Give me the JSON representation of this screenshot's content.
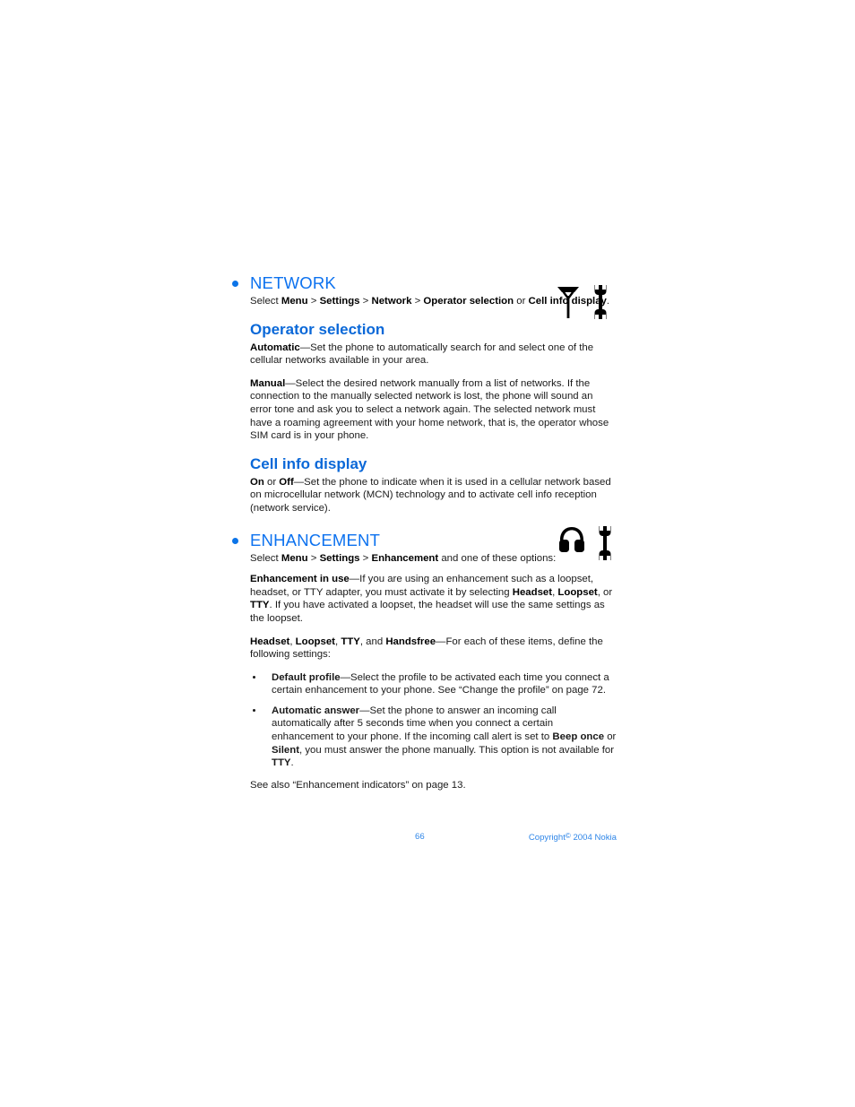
{
  "document": {
    "page_number": "66",
    "copyright_prefix": "Copyright",
    "copyright_symbol": "©",
    "copyright_suffix": "2004 Nokia",
    "accent_color": "#0d72ef",
    "subheading_color": "#0a68d8",
    "footer_color": "#2f86e8",
    "body_color": "#1a1a1a"
  },
  "sections": [
    {
      "id": "network",
      "title": "NETWORK",
      "icons": [
        "antenna-icon",
        "wrench-icon"
      ],
      "intro": {
        "segments": [
          {
            "text": "Select ",
            "bold": false
          },
          {
            "text": "Menu",
            "bold": true
          },
          {
            "text": " > ",
            "bold": false
          },
          {
            "text": "Settings",
            "bold": true
          },
          {
            "text": " > ",
            "bold": false
          },
          {
            "text": "Network",
            "bold": true
          },
          {
            "text": " > ",
            "bold": false
          },
          {
            "text": "Operator selection",
            "bold": true
          },
          {
            "text": " or ",
            "bold": false
          },
          {
            "text": "Cell info display",
            "bold": true
          },
          {
            "text": ".",
            "bold": false
          }
        ]
      },
      "subsections": [
        {
          "id": "operator-selection",
          "heading": "Operator selection",
          "paragraphs": [
            {
              "id": "automatic",
              "segments": [
                {
                  "text": "Automatic",
                  "bold": true
                },
                {
                  "text": "—Set the phone to automatically search for and select one of the cellular networks available in your area.",
                  "bold": false
                }
              ]
            },
            {
              "id": "manual",
              "segments": [
                {
                  "text": "Manual",
                  "bold": true
                },
                {
                  "text": "—Select the desired network manually from a list of networks. If the connection to the manually selected network is lost, the phone will sound an error tone and ask you to select a network again. The selected network must have a roaming agreement with your home network, that is, the operator whose SIM card is in your phone.",
                  "bold": false
                }
              ]
            }
          ]
        },
        {
          "id": "cell-info-display",
          "heading": "Cell info display",
          "paragraphs": [
            {
              "id": "on-off",
              "segments": [
                {
                  "text": "On",
                  "bold": true
                },
                {
                  "text": " or ",
                  "bold": false
                },
                {
                  "text": "Off",
                  "bold": true
                },
                {
                  "text": "—Set the phone to indicate when it is used in a cellular network based on microcellular network (MCN) technology and to activate cell info reception (network service).",
                  "bold": false
                }
              ]
            }
          ]
        }
      ]
    },
    {
      "id": "enhancement",
      "title": "ENHANCEMENT",
      "icons": [
        "headphones-icon",
        "wrench-icon"
      ],
      "intro": {
        "segments": [
          {
            "text": "Select ",
            "bold": false
          },
          {
            "text": "Menu",
            "bold": true
          },
          {
            "text": " > ",
            "bold": false
          },
          {
            "text": "Settings",
            "bold": true
          },
          {
            "text": " > ",
            "bold": false
          },
          {
            "text": "Enhancement",
            "bold": true
          },
          {
            "text": " and one of these options:",
            "bold": false
          }
        ]
      },
      "paragraphs": [
        {
          "id": "enhancement-in-use",
          "segments": [
            {
              "text": "Enhancement in use",
              "bold": true
            },
            {
              "text": "—If you are using an enhancement such as a loopset, headset, or TTY adapter, you must activate it by selecting ",
              "bold": false
            },
            {
              "text": "Headset",
              "bold": true
            },
            {
              "text": ", ",
              "bold": false
            },
            {
              "text": "Loopset",
              "bold": true
            },
            {
              "text": ", or ",
              "bold": false
            },
            {
              "text": "TTY",
              "bold": true
            },
            {
              "text": ". If you have activated a loopset, the headset will use the same settings as the loopset.",
              "bold": false
            }
          ]
        },
        {
          "id": "headset-loopset-tty-handsfree",
          "segments": [
            {
              "text": "Headset",
              "bold": true
            },
            {
              "text": ", ",
              "bold": false
            },
            {
              "text": "Loopset",
              "bold": true
            },
            {
              "text": ", ",
              "bold": false
            },
            {
              "text": "TTY",
              "bold": true
            },
            {
              "text": ", and ",
              "bold": false
            },
            {
              "text": "Handsfree",
              "bold": true
            },
            {
              "text": "—For each of these items, define the following settings:",
              "bold": false
            }
          ]
        }
      ],
      "bullets": [
        {
          "id": "default-profile",
          "segments": [
            {
              "text": "Default profile",
              "bold": true
            },
            {
              "text": "—Select the profile to be activated each time you connect a certain enhancement to your phone. See “Change the profile” on page 72.",
              "bold": false
            }
          ]
        },
        {
          "id": "automatic-answer",
          "segments": [
            {
              "text": "Automatic answer",
              "bold": true
            },
            {
              "text": "—Set the phone to answer an incoming call automatically after 5 seconds time when you connect a certain enhancement to your phone. If the incoming call alert is set to ",
              "bold": false
            },
            {
              "text": "Beep once",
              "bold": true
            },
            {
              "text": " or ",
              "bold": false
            },
            {
              "text": "Silent",
              "bold": true
            },
            {
              "text": ", you must answer the phone manually. This option is not available for ",
              "bold": false
            },
            {
              "text": "TTY",
              "bold": true
            },
            {
              "text": ".",
              "bold": false
            }
          ]
        }
      ],
      "closing": {
        "id": "see-also",
        "segments": [
          {
            "text": "See also “Enhancement indicators” on page 13.",
            "bold": false
          }
        ]
      }
    }
  ]
}
